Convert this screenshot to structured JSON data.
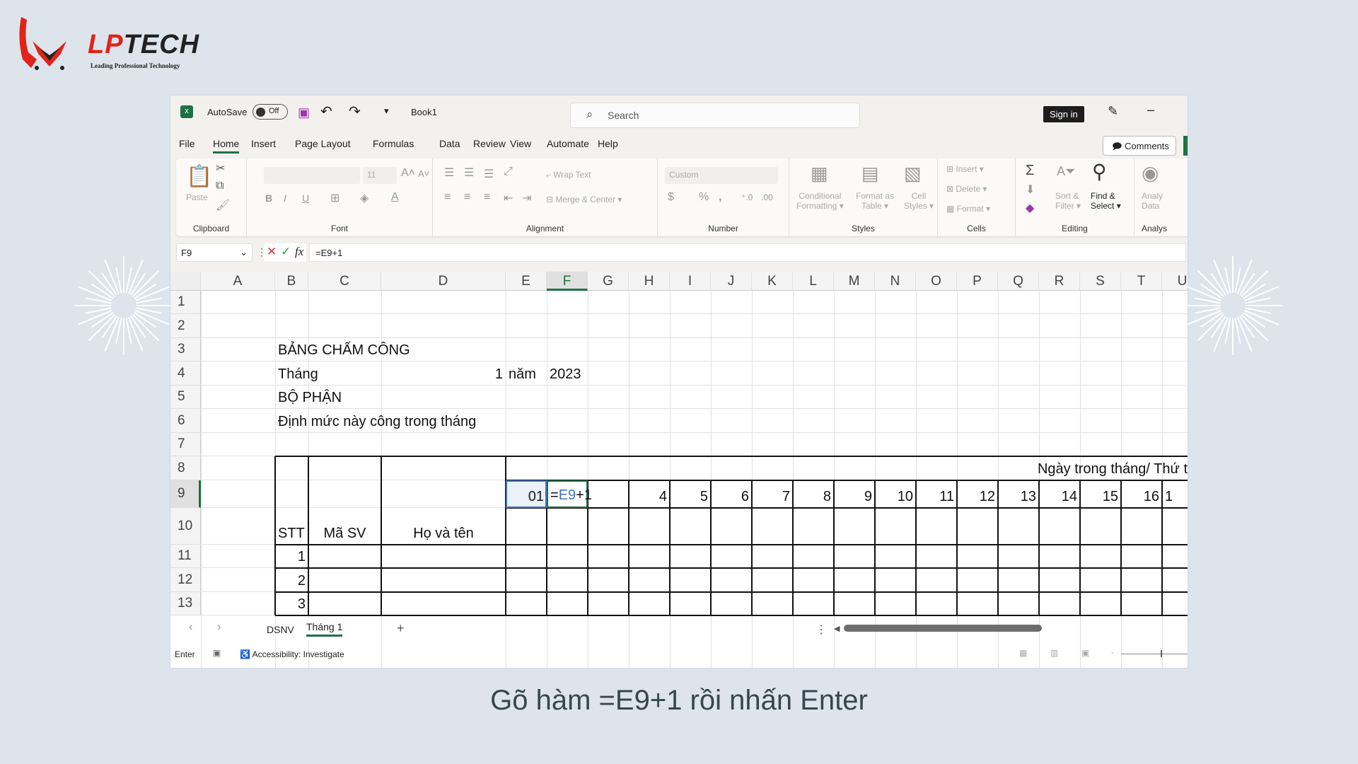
{
  "brand": {
    "logo_text": "LPTECH",
    "tagline": "Leading Professional Technology",
    "accent": "#e2231a"
  },
  "titlebar": {
    "autosave_label": "AutoSave",
    "autosave_state": "Off",
    "file_name": "Book1",
    "search_placeholder": "Search",
    "sign_in": "Sign in"
  },
  "menu": {
    "items": [
      "File",
      "Home",
      "Insert",
      "Page Layout",
      "Formulas",
      "Data",
      "Review",
      "View",
      "Automate",
      "Help"
    ],
    "active": "Home",
    "comments": "Comments"
  },
  "ribbon": {
    "clipboard": {
      "label": "Clipboard",
      "paste": "Paste"
    },
    "font": {
      "label": "Font",
      "size": "11"
    },
    "alignment": {
      "label": "Alignment",
      "wrap": "Wrap Text",
      "merge": "Merge & Center"
    },
    "number": {
      "label": "Number",
      "format": "Custom"
    },
    "styles": {
      "label": "Styles",
      "conditional": "Conditional",
      "conditional2": "Formatting",
      "format_table": "Format as",
      "format_table2": "Table",
      "cell_styles": "Cell",
      "cell_styles2": "Styles"
    },
    "cells": {
      "label": "Cells",
      "insert": "Insert",
      "delete": "Delete",
      "format": "Format"
    },
    "editing": {
      "label": "Editing",
      "sort": "Sort &",
      "sort2": "Filter",
      "find": "Find &",
      "find2": "Select"
    },
    "analysis": {
      "label": "Analys",
      "btn": "Analy",
      "btn2": "Data"
    }
  },
  "formula_bar": {
    "name_box": "F9",
    "formula": "=E9+1"
  },
  "sheet": {
    "columns": [
      "A",
      "B",
      "C",
      "D",
      "E",
      "F",
      "G",
      "H",
      "I",
      "J",
      "K",
      "L",
      "M",
      "N",
      "O",
      "P",
      "Q",
      "R",
      "S",
      "T",
      "U"
    ],
    "rows": [
      "1",
      "2",
      "3",
      "4",
      "5",
      "6",
      "7",
      "8",
      "9",
      "10",
      "11",
      "12",
      "13"
    ],
    "selected_cell": "F9",
    "cells": [
      {
        "ref": "B3",
        "text": "BẢNG CHẤM CÔNG",
        "align": "l"
      },
      {
        "ref": "B4",
        "text": "Tháng",
        "align": "l"
      },
      {
        "ref": "D4",
        "text": "1",
        "align": "r"
      },
      {
        "ref": "E4",
        "text": "năm",
        "align": "l"
      },
      {
        "ref": "F4",
        "text": "2023",
        "align": "l"
      },
      {
        "ref": "B5",
        "text": "BỘ PHẬN",
        "align": "l"
      },
      {
        "ref": "B6",
        "text": "Định mức này công trong tháng",
        "align": "l"
      },
      {
        "ref": "E9",
        "text": "01",
        "align": "r"
      },
      {
        "ref": "H9",
        "text": "4",
        "align": "r"
      },
      {
        "ref": "I9",
        "text": "5",
        "align": "r"
      },
      {
        "ref": "J9",
        "text": "6",
        "align": "r"
      },
      {
        "ref": "K9",
        "text": "7",
        "align": "r"
      },
      {
        "ref": "L9",
        "text": "8",
        "align": "r"
      },
      {
        "ref": "M9",
        "text": "9",
        "align": "r"
      },
      {
        "ref": "N9",
        "text": "10",
        "align": "r"
      },
      {
        "ref": "O9",
        "text": "11",
        "align": "r"
      },
      {
        "ref": "P9",
        "text": "12",
        "align": "r"
      },
      {
        "ref": "Q9",
        "text": "13",
        "align": "r"
      },
      {
        "ref": "R9",
        "text": "14",
        "align": "r"
      },
      {
        "ref": "S9",
        "text": "15",
        "align": "r"
      },
      {
        "ref": "T9",
        "text": "16",
        "align": "r"
      },
      {
        "ref": "U9",
        "text": "1",
        "align": "l"
      },
      {
        "ref": "B10",
        "text": "STT",
        "align": "l"
      },
      {
        "ref": "C10",
        "text": "Mã SV",
        "align": "c"
      },
      {
        "ref": "D10",
        "text": "Họ và tên",
        "align": "c"
      },
      {
        "ref": "B11",
        "text": "1",
        "align": "r"
      },
      {
        "ref": "B12",
        "text": "2",
        "align": "r"
      },
      {
        "ref": "B13",
        "text": "3",
        "align": "r"
      }
    ],
    "header_merged": "Ngày trong tháng/ Thứ t",
    "editing": {
      "ref": "F9",
      "prefix": "=",
      "ref_text": "E9",
      "suffix": "+1",
      "ref_color": "#4472c4"
    }
  },
  "tabs": {
    "items": [
      "DSNV",
      "Tháng 1"
    ],
    "active": "Tháng 1",
    "add": "+"
  },
  "status": {
    "mode": "Enter",
    "accessibility": "Accessibility: Investigate"
  },
  "caption": "Gõ hàm =E9+1 rồi nhấn Enter"
}
